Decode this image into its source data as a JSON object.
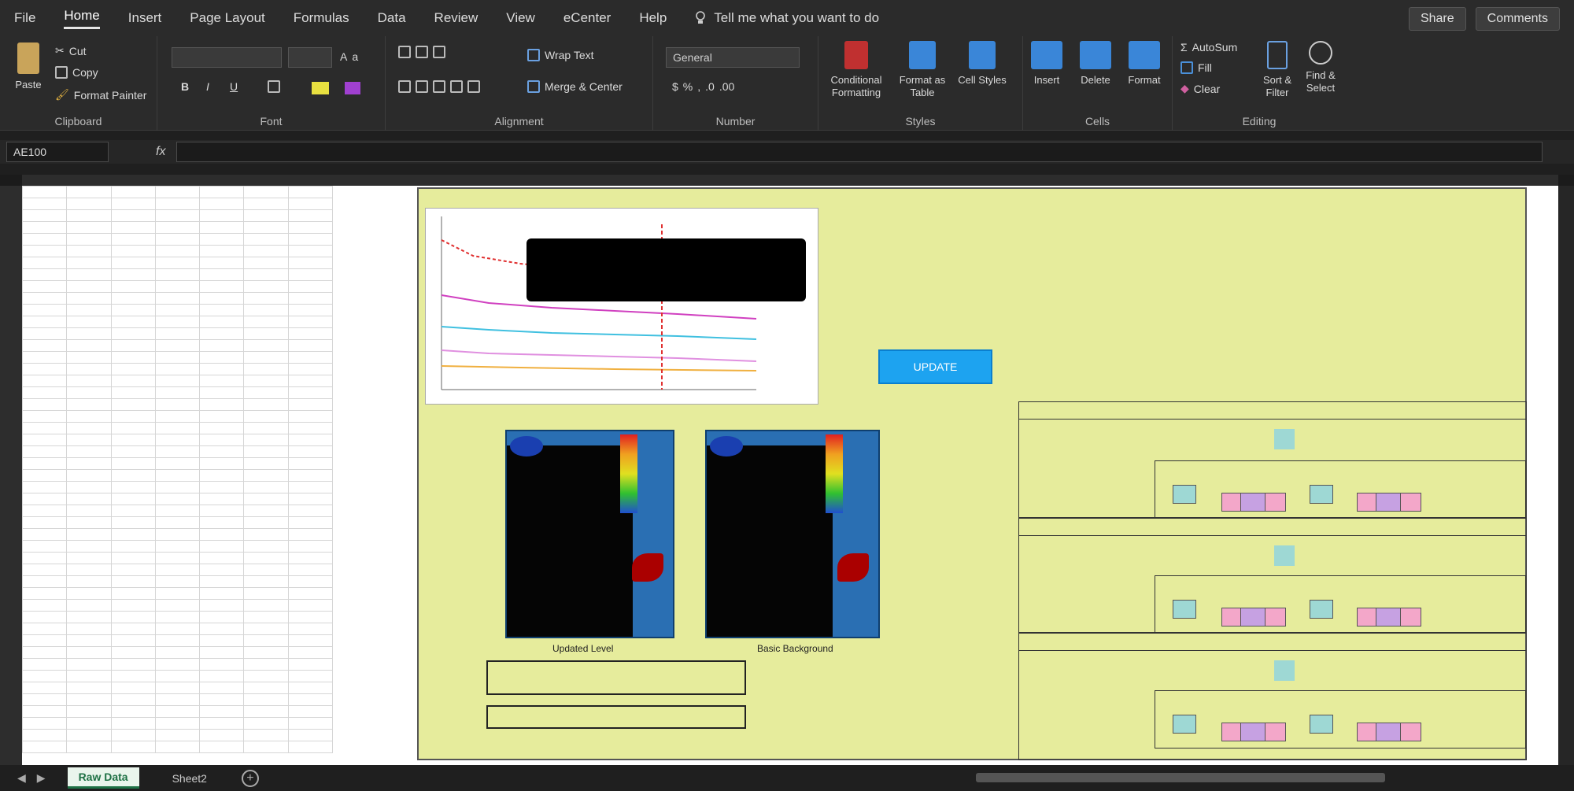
{
  "menu": {
    "items": [
      "File",
      "Home",
      "Insert",
      "Page Layout",
      "Formulas",
      "Data",
      "Review",
      "View",
      "eCenter",
      "Help"
    ],
    "active": "Home",
    "tell_me": "Tell me what you want to do",
    "share": "Share",
    "comments": "Comments"
  },
  "ribbon": {
    "clipboard": {
      "label": "Clipboard",
      "paste": "Paste",
      "cut": "Cut",
      "copy": "Copy",
      "format_painter": "Format Painter"
    },
    "font": {
      "label": "Font"
    },
    "alignment": {
      "label": "Alignment",
      "wrap_text": "Wrap Text",
      "merge_center": "Merge & Center"
    },
    "number": {
      "label": "Number",
      "format": "General"
    },
    "styles": {
      "label": "Styles",
      "conditional": "Conditional Formatting",
      "format_table": "Format as Table",
      "cell_styles": "Cell Styles"
    },
    "cells": {
      "label": "Cells",
      "insert": "Insert",
      "delete": "Delete",
      "format": "Format"
    },
    "editing": {
      "label": "Editing",
      "autosum": "AutoSum",
      "fill": "Fill",
      "clear": "Clear",
      "sort": "Sort & Filter",
      "find": "Find & Select"
    }
  },
  "formula_bar": {
    "name_box": "AE100",
    "fx": "fx"
  },
  "dashboard": {
    "button_label": "UPDATE",
    "heatmap_caption_left": "Updated Level",
    "heatmap_caption_right": "Basic Background"
  },
  "tabs": {
    "active": "Raw Data",
    "other": "Sheet2"
  },
  "colors": {
    "dashboard_bg": "#e6ec9c",
    "teal": "#9ed8d4",
    "pink": "#f3a7c9",
    "violet": "#c6a1e2",
    "excel_green": "#1e7145",
    "button_blue": "#1da3f0"
  }
}
